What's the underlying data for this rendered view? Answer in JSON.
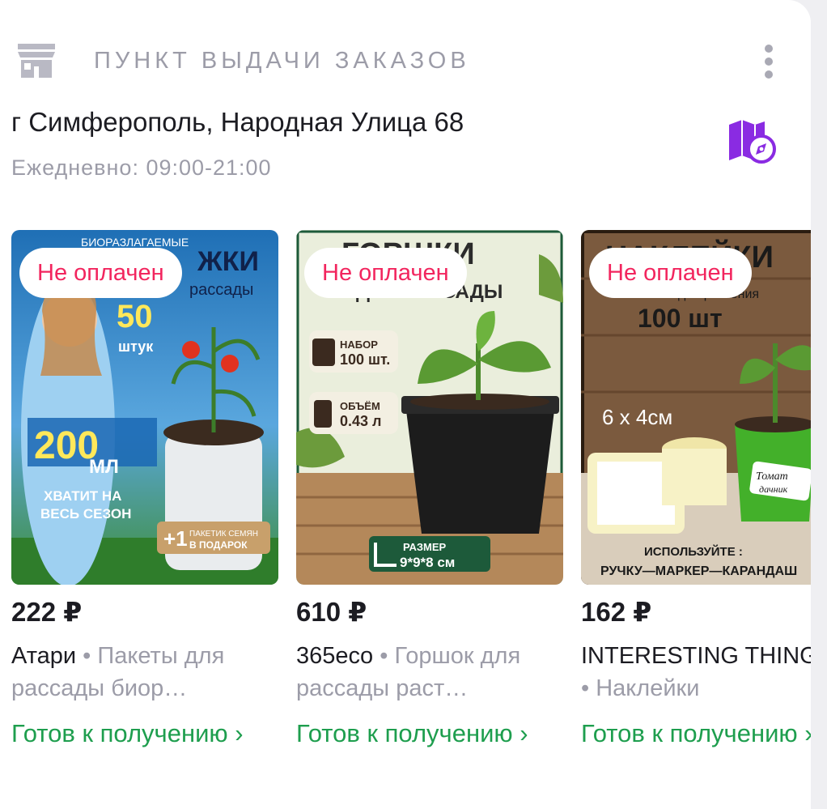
{
  "header": {
    "title": "ПУНКТ ВЫДАЧИ ЗАКАЗОВ",
    "store_icon": "store-icon",
    "menu_icon": "more-vertical-icon"
  },
  "pickup": {
    "address": "г Симферополь, Народная Улица 68",
    "hours": "Ежедневно: 09:00-21:00",
    "map_icon": "map-compass-icon"
  },
  "products": [
    {
      "badge": "Не оплачен",
      "price": "222 ₽",
      "brand": "Атари",
      "separator": " • ",
      "name": "Пакеты для рассады биор…",
      "status": "Готов к получению ›",
      "image_text": {
        "top": "БИОРАЗЛАГАЕМЫЕ",
        "headline": "ЖКИ",
        "sub": "рассады",
        "count": "50",
        "count_unit": "штук",
        "volume": "200",
        "volume_unit": "МЛ",
        "season1": "ХВАТИТ НА",
        "season2": "ВЕСЬ СЕЗОН",
        "gift_plus": "+1",
        "gift1": "ПАКЕТИК СЕМЯН",
        "gift2": "В ПОДАРОК"
      }
    },
    {
      "badge": "Не оплачен",
      "price": "610 ₽",
      "brand": "365eco",
      "separator": " • ",
      "name": "Горшок для рассады раст…",
      "status": "Готов к получению ›",
      "image_text": {
        "headline": "ГОРШКИ",
        "sub": "ДЛЯ РАССАДЫ",
        "set_label": "НАБОР",
        "set_value": "100 шт.",
        "vol_label": "ОБЪЁМ",
        "vol_value": "0.43 л",
        "size_label": "РАЗМЕР",
        "size_value": "9*9*8 см"
      }
    },
    {
      "badge": "Не оплачен",
      "price": "162 ₽",
      "brand": "INTERESTING THINGS",
      "separator": " • ",
      "name": "Наклейки",
      "status": "Готов к получению ›",
      "image_text": {
        "headline": "НАКЛЕЙКИ",
        "sub": "для растения",
        "count": "100 шт",
        "size": "6 х 4см",
        "tag1": "Томат",
        "tag2": "дачник",
        "use": "ИСПОЛЬЗУЙТЕ :",
        "tools": "РУЧКУ—МАРКЕР—КАРАНДАШ"
      }
    }
  ],
  "colors": {
    "accent_purple": "#8a2be2",
    "status_green": "#1e9e4e",
    "badge_red": "#f2255e"
  }
}
